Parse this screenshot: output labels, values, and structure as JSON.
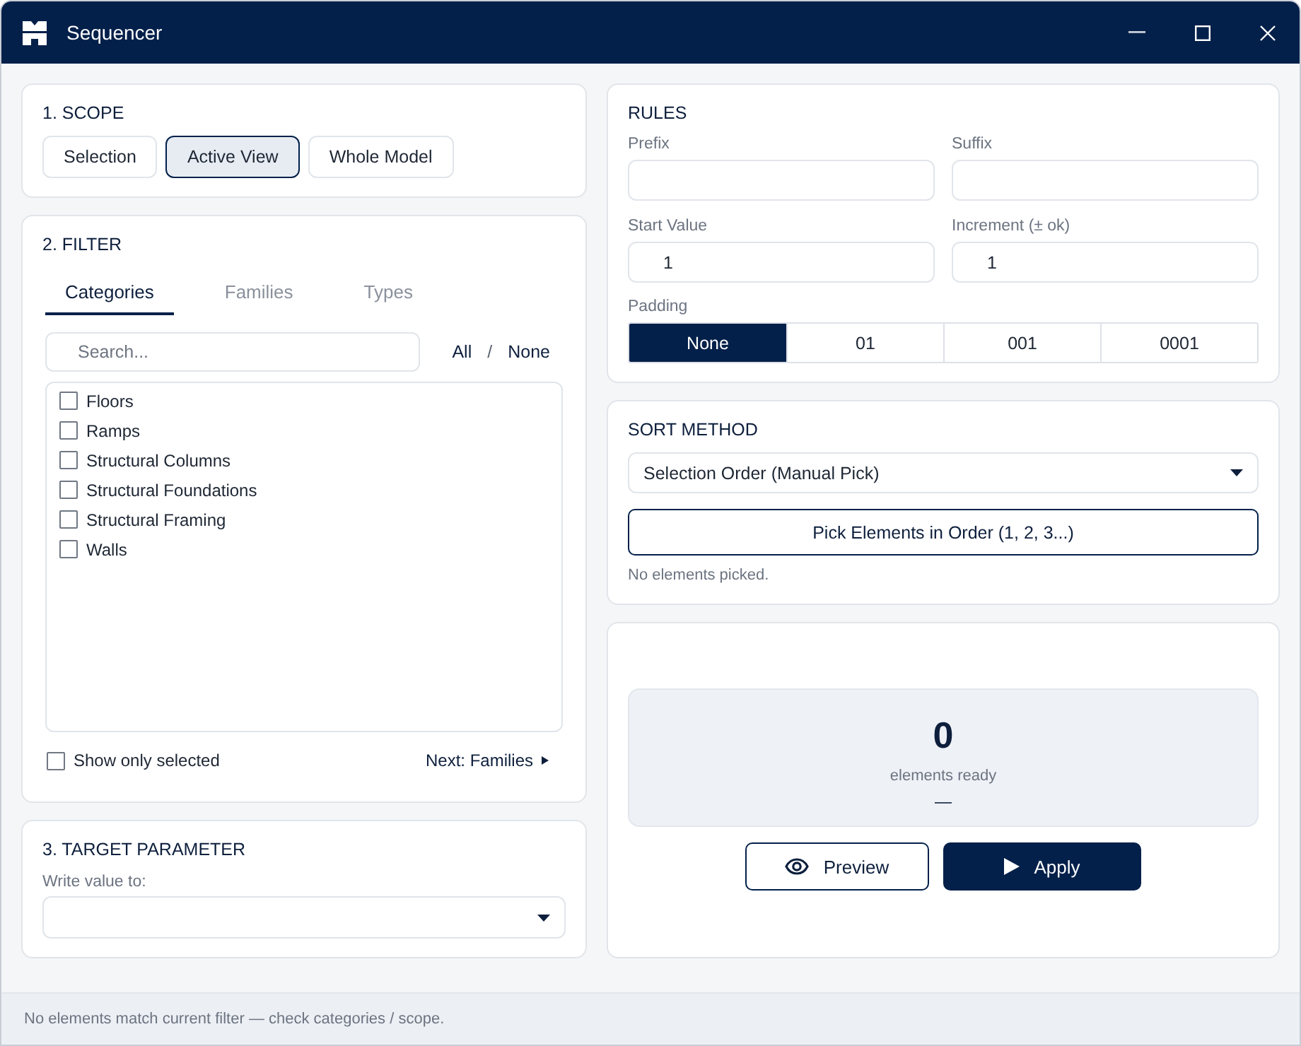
{
  "window": {
    "title": "Sequencer"
  },
  "scope": {
    "title": "1. SCOPE",
    "options": [
      {
        "label": "Selection",
        "selected": false
      },
      {
        "label": "Active View",
        "selected": true
      },
      {
        "label": "Whole Model",
        "selected": false
      }
    ]
  },
  "filter": {
    "title": "2. FILTER",
    "tabs": [
      {
        "label": "Categories",
        "selected": true
      },
      {
        "label": "Families",
        "selected": false
      },
      {
        "label": "Types",
        "selected": false
      }
    ],
    "search": {
      "placeholder": "Search..."
    },
    "select_all": "All",
    "separator": "/",
    "select_none": "None",
    "categories": [
      {
        "label": "Floors",
        "checked": false
      },
      {
        "label": "Ramps",
        "checked": false
      },
      {
        "label": "Structural Columns",
        "checked": false
      },
      {
        "label": "Structural Foundations",
        "checked": false
      },
      {
        "label": "Structural Framing",
        "checked": false
      },
      {
        "label": "Walls",
        "checked": false
      }
    ],
    "show_only_selected": {
      "label": "Show only selected",
      "checked": false
    },
    "next_button": "Next: Families"
  },
  "target_parameter": {
    "title": "3. TARGET PARAMETER",
    "label": "Write value to:"
  },
  "rules": {
    "title": "RULES",
    "fields": [
      {
        "label": "Prefix"
      },
      {
        "label": "Suffix"
      },
      {
        "label": "Start Value",
        "value": "1"
      },
      {
        "label": "Increment (± ok)",
        "value": "1"
      }
    ],
    "padding": {
      "label": "Padding",
      "options": [
        {
          "label": "None",
          "selected": true
        },
        {
          "label": "01",
          "selected": false
        },
        {
          "label": "001",
          "selected": false
        },
        {
          "label": "0001",
          "selected": false
        }
      ]
    }
  },
  "sort_method": {
    "title": "SORT METHOD",
    "value": "Selection Order (Manual Pick)",
    "pick_button": "Pick Elements in Order (1, 2, 3...)",
    "note": "No elements picked."
  },
  "summary": {
    "count": "0",
    "caption": "elements ready",
    "detail": "—",
    "buttons": [
      {
        "kind": "preview",
        "label": "Preview"
      },
      {
        "kind": "apply",
        "label": "Apply"
      }
    ]
  },
  "status_bar": {
    "message": "No elements match current filter — check categories / scope."
  }
}
